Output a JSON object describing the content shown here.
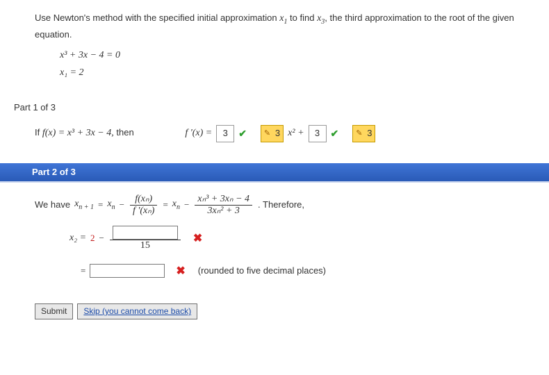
{
  "prompt": {
    "line1": "Use Newton's method with the specified initial approximation ",
    "x1sym": "x",
    "x1sub": "1",
    "line1b": " to find ",
    "x3sym": "x",
    "x3sub": "3",
    "line1c": ", the third approximation to the root of the given equation."
  },
  "equation": "x³ + 3x − 4 = 0",
  "initial": "x₁ = 2",
  "part1": {
    "label": "Part 1 of 3",
    "lead": "If ",
    "fx_expr": "f(x) = x³ + 3x − 4,",
    "then": " then",
    "fprime_lhs": "f '(x) = ",
    "ans1": "3",
    "lock1": "3",
    "mid": " x² + ",
    "ans2": "3",
    "lock2": "3"
  },
  "part2": {
    "header": "Part 2 of 3",
    "lead": "We have ",
    "xn1_lhs_x": "x",
    "xn1_lhs_sub": "n + 1",
    "eq": " = ",
    "xn": "x",
    "xnsub": "n",
    "minus": " − ",
    "fnum": "f(xₙ)",
    "fden": "f '(xₙ)",
    "eq2": " = ",
    "rnum": "xₙ³ + 3xₙ − 4",
    "rden": "3xₙ² + 3",
    "therefore": ". Therefore,",
    "x2_lhs": "x₂ = ",
    "x2_rhs_val": "2",
    "x2_rhs_minus": " − ",
    "frac_under_num": "",
    "frac_under_den": "15",
    "eq3": "= ",
    "tail": "(rounded to five decimal places)"
  },
  "footer": {
    "submit": "Submit",
    "skip": "Skip (you cannot come back)"
  }
}
